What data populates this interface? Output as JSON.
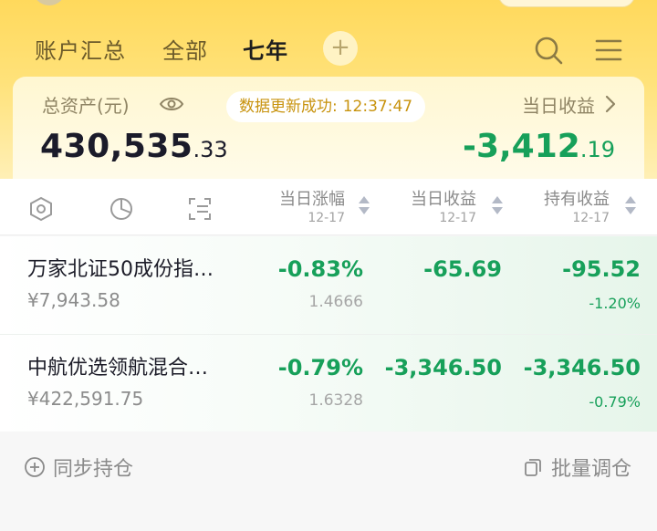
{
  "tabs": [
    {
      "label": "账户汇总"
    },
    {
      "label": "全部"
    },
    {
      "label": "七年"
    }
  ],
  "tab_add_label": "+",
  "summary": {
    "asset_label": "总资产(元)",
    "asset_int": "430,535",
    "asset_dec": ".33",
    "update_text": "数据更新成功:",
    "update_time": "12:37:47",
    "daily_label": "当日收益",
    "daily_int": "-3,412",
    "daily_dec": ".19"
  },
  "columns": [
    {
      "title": "当日涨幅",
      "date": "12-17"
    },
    {
      "title": "当日收益",
      "date": "12-17"
    },
    {
      "title": "持有收益",
      "date": "12-17"
    }
  ],
  "funds": [
    {
      "name": "万家北证50成份指…",
      "amount": "¥7,943.58",
      "change": "-0.83%",
      "nav": "1.4666",
      "daily": "-65.69",
      "hold": "-95.52",
      "hold_pct": "-1.20%"
    },
    {
      "name": "中航优选领航混合…",
      "amount": "¥422,591.75",
      "change": "-0.79%",
      "nav": "1.6328",
      "daily": "-3,346.50",
      "hold": "-3,346.50",
      "hold_pct": "-0.79%"
    }
  ],
  "footer": {
    "sync_label": "同步持仓",
    "batch_label": "批量调仓"
  },
  "colors": {
    "header_yellow": "#ffd95c",
    "loss_green": "#17a05a",
    "update_text": "#c8930e"
  }
}
